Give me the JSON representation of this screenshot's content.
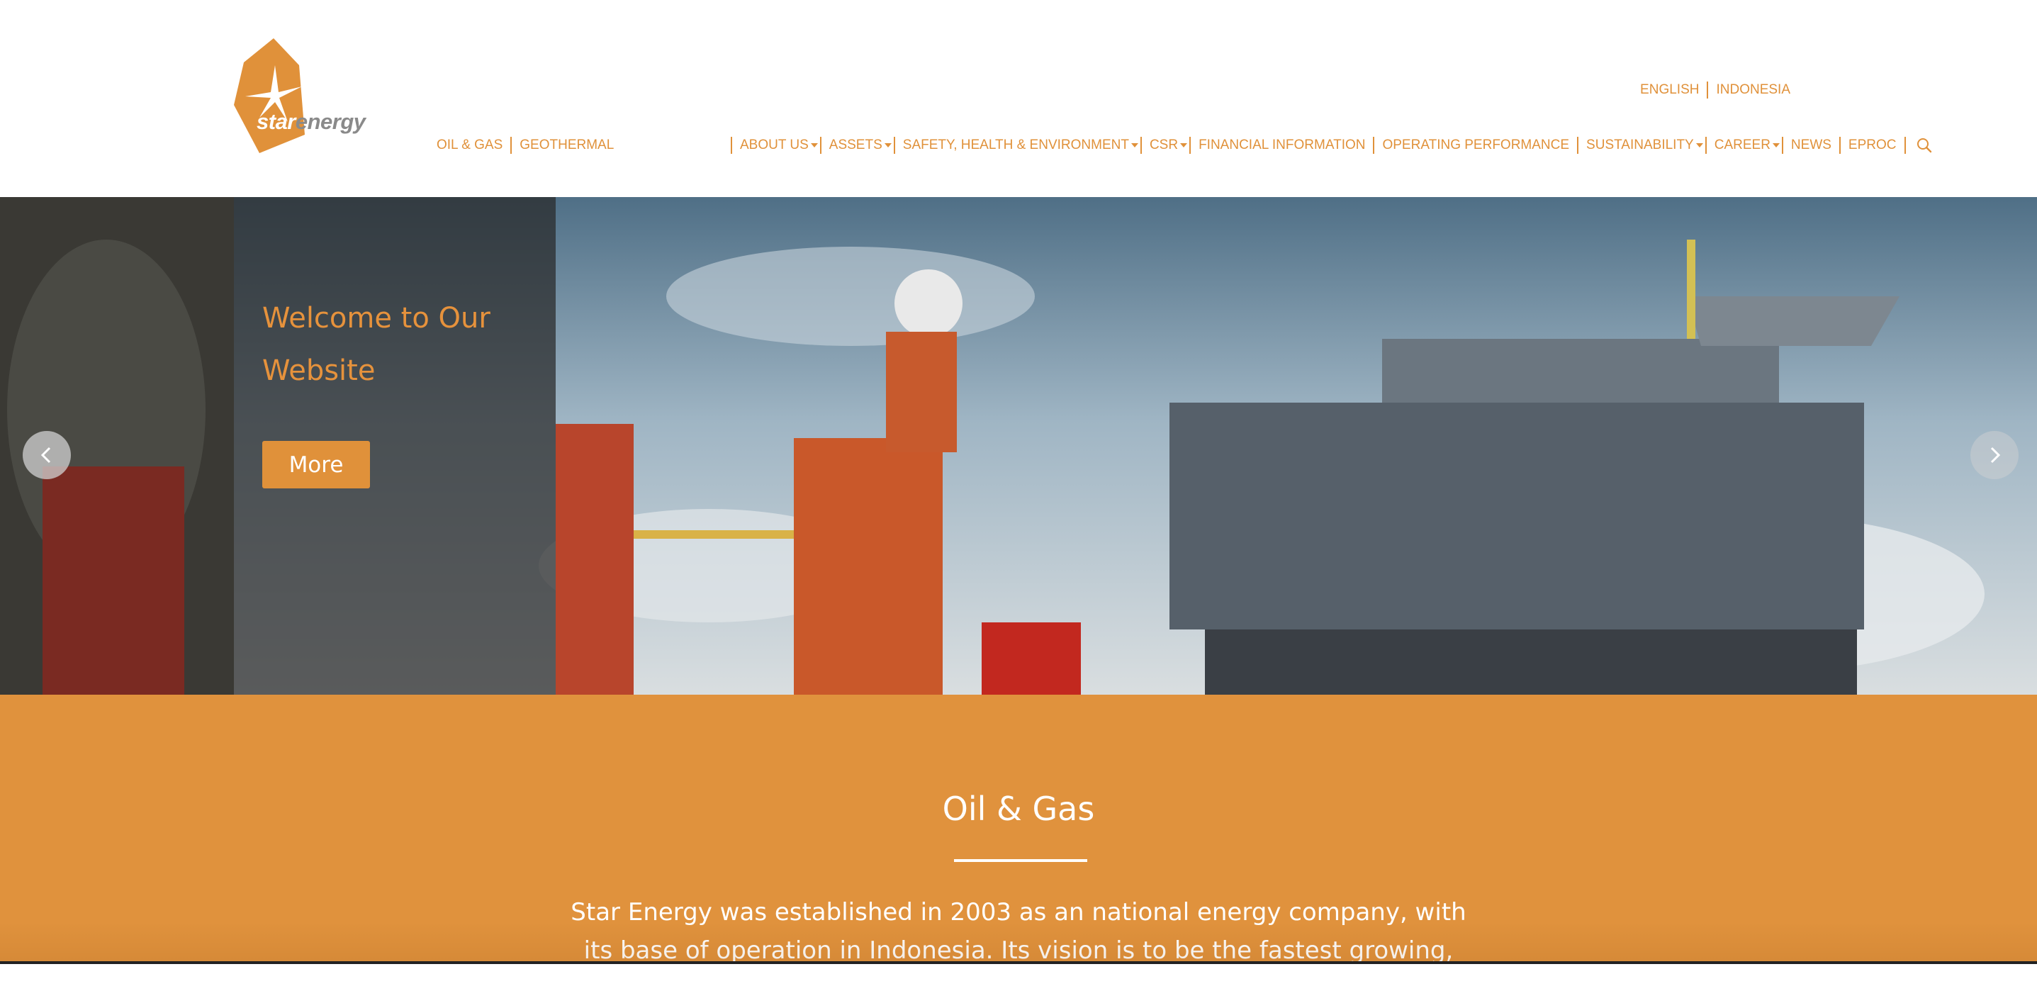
{
  "brand": {
    "logo_word_1": "star",
    "logo_word_2": "energy",
    "color": "#e0913a"
  },
  "language": {
    "options": [
      "ENGLISH",
      "INDONESIA"
    ]
  },
  "subnav": [
    "OIL & GAS",
    "GEOTHERMAL"
  ],
  "nav": {
    "items": [
      {
        "label": "ABOUT US",
        "dropdown": true
      },
      {
        "label": "ASSETS",
        "dropdown": true
      },
      {
        "label": "SAFETY, HEALTH & ENVIRONMENT",
        "dropdown": true
      },
      {
        "label": "CSR",
        "dropdown": true
      },
      {
        "label": "FINANCIAL INFORMATION",
        "dropdown": false
      },
      {
        "label": "OPERATING PERFORMANCE",
        "dropdown": false
      },
      {
        "label": "SUSTAINABILITY",
        "dropdown": true
      },
      {
        "label": "CAREER",
        "dropdown": true
      },
      {
        "label": "NEWS",
        "dropdown": false
      },
      {
        "label": "EPROC",
        "dropdown": false
      }
    ],
    "search_icon": "search-icon"
  },
  "hero": {
    "title": "Welcome to Our Website",
    "button_label": "More",
    "prev_icon": "chevron-left-icon",
    "next_icon": "chevron-right-icon"
  },
  "section": {
    "title": "Oil & Gas",
    "text": "Star Energy was established in 2003 as an national energy company, with its base of operation in Indonesia. Its vision is to be the fastest growing, most profitable,"
  }
}
